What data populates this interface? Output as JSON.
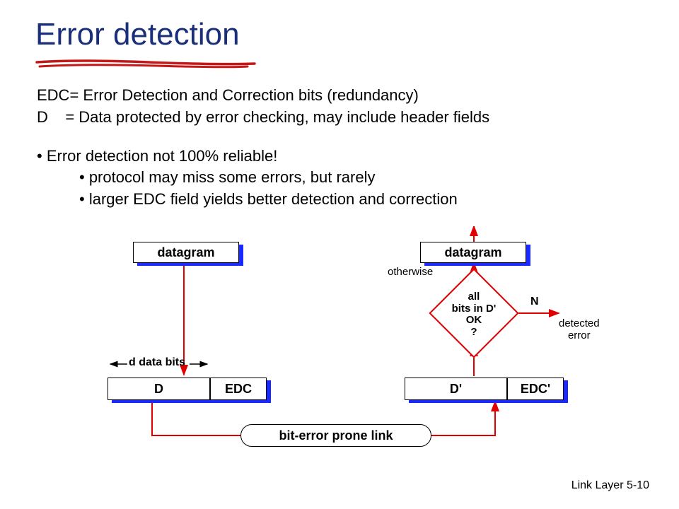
{
  "title": "Error detection",
  "text": {
    "edc": "EDC= Error Detection and Correction bits (redundancy)",
    "d": "D    = Data protected by error checking, may include header fields",
    "bullet1": "• Error detection not 100% reliable!",
    "bullet2": "• protocol may miss some errors, but rarely",
    "bullet3": "• larger EDC field yields better detection and correction"
  },
  "diagram": {
    "datagram_left": "datagram",
    "datagram_right": "datagram",
    "otherwise": "otherwise",
    "d_bits": "d data bits",
    "packet_left_D": "D",
    "packet_left_EDC": "EDC",
    "packet_right_D": "D'",
    "packet_right_EDC": "EDC'",
    "link": "bit-error prone link",
    "diamond": "all\nbits in D'\nOK\n?",
    "no": "N",
    "detected": "detected\nerror"
  },
  "footer": "Link Layer  5-10"
}
